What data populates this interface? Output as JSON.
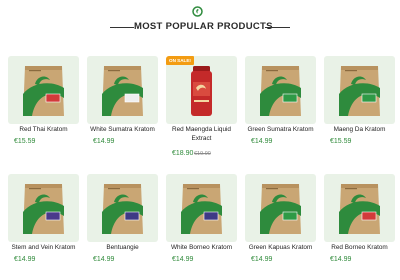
{
  "header": {
    "title": "MOST POPULAR PRODUCTS",
    "logo": "leaf-swirl-icon",
    "brand_color": "#2e8b3d"
  },
  "products": [
    {
      "name": "Red Thai Kratom",
      "price": "€15.59",
      "strain_color": "#d23a3a"
    },
    {
      "name": "White Sumatra Kratom",
      "price": "€14.99",
      "strain_color": "#efefef"
    },
    {
      "name": "Red Maengda Liquid Extract",
      "price": "€18.90",
      "old_price": "€19.90",
      "badge": "ON SALE!",
      "strain_color": "#c42a2a"
    },
    {
      "name": "Green Sumatra Kratom",
      "price": "€14.99",
      "strain_color": "#2e9a46"
    },
    {
      "name": "Maeng Da Kratom",
      "price": "€15.59",
      "strain_color": "#2e9a46"
    },
    {
      "name": "Stem and Vein Kratom",
      "price": "€14.99",
      "strain_color": "#4a3a8c"
    },
    {
      "name": "Bentuangie",
      "price": "€14.99",
      "strain_color": "#3e3a86"
    },
    {
      "name": "White Borneo Kratom",
      "price": "€14.99",
      "strain_color": "#3e3a86"
    },
    {
      "name": "Green Kapuas Kratom",
      "price": "€14.99",
      "strain_color": "#2e9a46"
    },
    {
      "name": "Red Borneo Kratom",
      "price": "€14.99",
      "strain_color": "#d23a3a"
    }
  ]
}
